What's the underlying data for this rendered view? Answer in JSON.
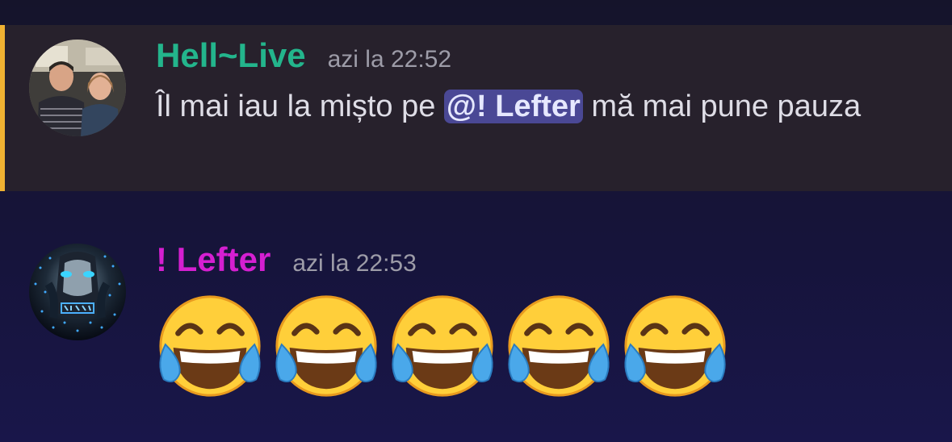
{
  "messages": [
    {
      "username": "Hell~Live",
      "username_color": "#23b58c",
      "timestamp": "azi la 22:52",
      "text_before": "Îl mai iau la mișto pe ",
      "mention": "@! Lefter",
      "text_after": " mă mai pune pauza",
      "highlighted": true,
      "highlight_bar_color": "#f0b232"
    },
    {
      "username": "! Lefter",
      "username_color": "#d51fd1",
      "timestamp": "azi la 22:53",
      "emoji_name": "face-with-tears-of-joy",
      "emoji_count": 5
    }
  ]
}
